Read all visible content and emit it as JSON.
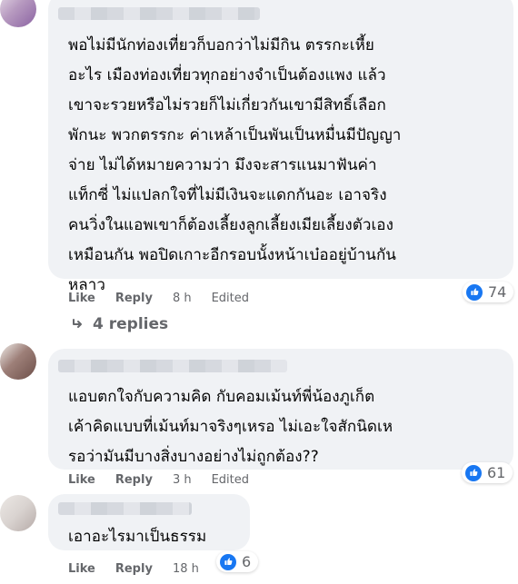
{
  "comments": [
    {
      "text": "พอไม่มีนักท่องเที่ยวก็บอกว่าไม่มีกิน ตรรกะเหี้ย\nอะไร เมืองท่องเที่ยวทุกอย่างจำเป็นต้องแพง แล้ว\nเขาจะรวยหรือไม่รวยก็ไม่เกี่ยวกันเขามีสิทธิ์เลือก\nพักนะ พวกตรรกะ ค่าเหล้าเป็นพันเป็นหมื่นมีปัญญา\nจ่าย ไม่ได้หมายความว่า มึงจะสารแนมาฟันค่า\nแท็กซี่ ไม่แปลกใจที่ไม่มีเงินจะแดกกันอะ เอาจริง\nคนวิ่งในแอพเขาก็ต้องเลี้ยงลูกเลี้ยงเมียเลี้ยงตัวเอง\nเหมือนกัน พอปิดเกาะอีกรอบนั้งหน้าเบ๋ออยู่บ้านกัน\nหลาว",
      "like_label": "Like",
      "reply_label": "Reply",
      "time": "8 h",
      "edited": "Edited",
      "reaction_count": "74",
      "reaction_icon": "like-icon"
    },
    {
      "text": "แอบตกใจกับความคิด กับคอมเม้นท์พี่น้องภูเก็ต\nเค้าคิดแบบที่เม้นท์มาจริงๆเหรอ ไม่เอะใจสักนิดเห\nรอว่ามันมีบางสิ่งบางอย่างไม่ถูกต้อง??",
      "like_label": "Like",
      "reply_label": "Reply",
      "time": "3 h",
      "edited": "Edited",
      "reaction_count": "61",
      "reaction_icon": "like-icon"
    },
    {
      "text": "เอาอะไรมาเป็นธรรม",
      "like_label": "Like",
      "reply_label": "Reply",
      "time": "18 h",
      "reaction_count": "6",
      "reaction_icon": "like-icon"
    }
  ],
  "thread": {
    "replies_label": "4 replies",
    "reply_icon": "reply-arrow-icon"
  },
  "colors": {
    "bubble": "#f0f2f5",
    "meta_text": "#65676b",
    "like_blue": "#1877f2",
    "body_text": "#050505"
  }
}
